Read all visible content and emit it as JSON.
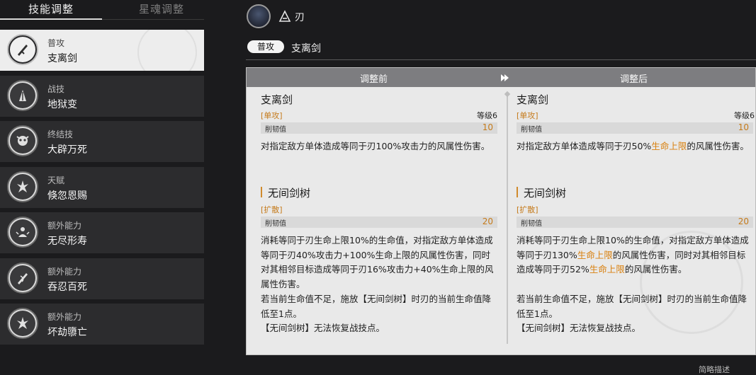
{
  "tabs": {
    "active": "技能调整",
    "inactive": "星魂调整"
  },
  "skills": [
    {
      "type": "普攻",
      "name": "支离剑",
      "icon": "sword-skill-icon"
    },
    {
      "type": "战技",
      "name": "地狱变",
      "icon": "flame-blade-icon"
    },
    {
      "type": "终结技",
      "name": "大辟万死",
      "icon": "demon-mask-icon"
    },
    {
      "type": "天赋",
      "name": "倏忽恩赐",
      "icon": "talent-icon"
    },
    {
      "type": "额外能力",
      "name": "无尽形寿",
      "icon": "figure-icon"
    },
    {
      "type": "额外能力",
      "name": "吞忍百死",
      "icon": "sword-wrap-icon"
    },
    {
      "type": "额外能力",
      "name": "坏劫隳亡",
      "icon": "trace-icon"
    }
  ],
  "character": {
    "name": "刃",
    "path_icon": "destruction-path-icon",
    "avatar": "blade-avatar"
  },
  "selected": {
    "badge": "普攻",
    "skill": "支离剑"
  },
  "compare": {
    "before_label": "调整前",
    "after_label": "调整后"
  },
  "before": {
    "title": "支离剑",
    "tag": "[单攻]",
    "level": "等级6",
    "toughness_label": "削韧值",
    "toughness_value": "10",
    "desc": "对指定敌方单体造成等同于刃100%攻击力的风属性伤害。",
    "sub_title": "无间剑树",
    "sub_tag": "[扩散]",
    "sub_toughness_label": "削韧值",
    "sub_toughness_value": "20",
    "sub_desc": "消耗等同于刃生命上限10%的生命值，对指定敌方单体造成等同于刃40%攻击力+100%生命上限的风属性伤害，同时对其相邻目标造成等同于刃16%攻击力+40%生命上限的风属性伤害。",
    "sub_note1": "若当前生命值不足，施放【无间剑树】时刃的当前生命值降低至1点。",
    "sub_note2": "【无间剑树】无法恢复战技点。"
  },
  "after": {
    "title": "支离剑",
    "tag": "[单攻]",
    "level": "等级6",
    "toughness_label": "削韧值",
    "toughness_value": "10",
    "desc_a": "对指定敌方单体造成等同于刃50%",
    "desc_hl": "生命上限",
    "desc_b": "的风属性伤害。",
    "sub_title": "无间剑树",
    "sub_tag": "[扩散]",
    "sub_toughness_label": "削韧值",
    "sub_toughness_value": "20",
    "sub_desc_a": "消耗等同于刃生命上限10%的生命值，对指定敌方单体造成等同于刃130%",
    "sub_desc_hl1": "生命上限",
    "sub_desc_b": "的风属性伤害，同时对其相邻目标造成等同于刃52%",
    "sub_desc_hl2": "生命上限",
    "sub_desc_c": "的风属性伤害。",
    "sub_note1": "若当前生命值不足，施放【无间剑树】时刃的当前生命值降低至1点。",
    "sub_note2": "【无间剑树】无法恢复战技点。"
  },
  "footer": {
    "hint": "简略描述"
  },
  "colors": {
    "accent": "#c57a1a",
    "highlight": "#d9800e",
    "panel_bg": "#e9e9e9",
    "header_bg": "#7d7d80"
  }
}
